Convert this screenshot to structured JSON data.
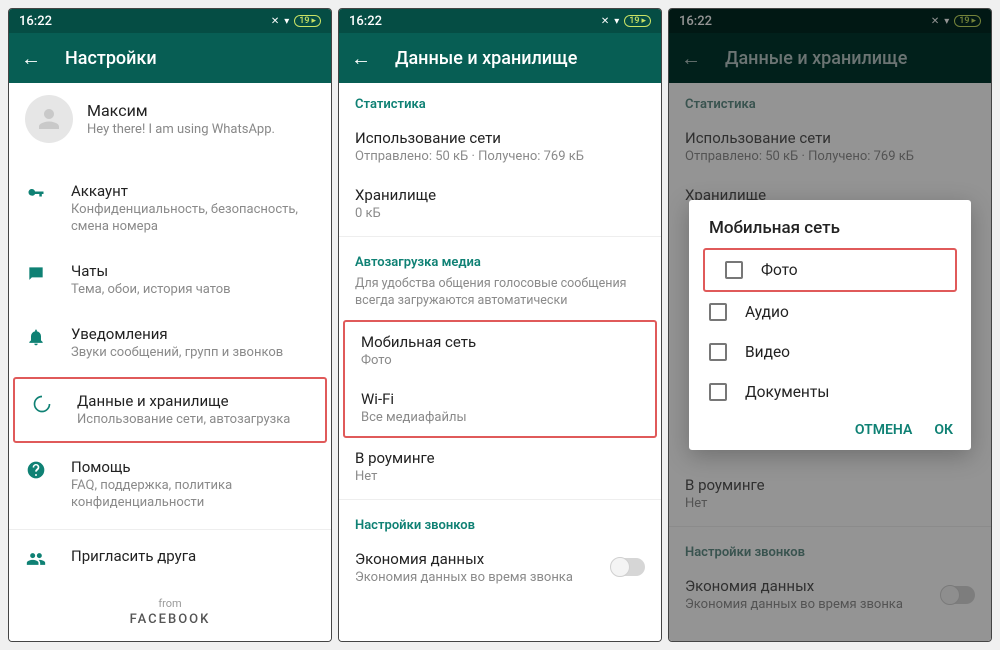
{
  "status": {
    "time": "16:22",
    "battery": "19"
  },
  "panel1": {
    "title": "Настройки",
    "profile": {
      "name": "Максим",
      "status": "Hey there! I am using WhatsApp."
    },
    "rows": {
      "account": {
        "title": "Аккаунт",
        "sub": "Конфиденциальность, безопасность, смена номера"
      },
      "chats": {
        "title": "Чаты",
        "sub": "Тема, обои, история чатов"
      },
      "notif": {
        "title": "Уведомления",
        "sub": "Звуки сообщений, групп и звонков"
      },
      "data": {
        "title": "Данные и хранилище",
        "sub": "Использование сети, автозагрузка"
      },
      "help": {
        "title": "Помощь",
        "sub": "FAQ, поддержка, политика конфиденциальности"
      },
      "invite": {
        "title": "Пригласить друга"
      }
    },
    "footer_from": "from",
    "footer_brand": "FACEBOOK"
  },
  "panel2": {
    "title": "Данные и хранилище",
    "sec_stats": "Статистика",
    "network": {
      "title": "Использование сети",
      "sub": "Отправлено: 50 кБ · Получено: 769 кБ"
    },
    "storage": {
      "title": "Хранилище",
      "sub": "0 кБ"
    },
    "sec_media": "Автозагрузка медиа",
    "media_note": "Для удобства общения голосовые сообщения всегда загружаются автоматически",
    "mobile": {
      "title": "Мобильная сеть",
      "sub": "Фото"
    },
    "wifi": {
      "title": "Wi-Fi",
      "sub": "Все медиафайлы"
    },
    "roaming": {
      "title": "В роуминге",
      "sub": "Нет"
    },
    "sec_calls": "Настройки звонков",
    "economy": {
      "title": "Экономия данных",
      "sub": "Экономия данных во время звонка"
    }
  },
  "panel3": {
    "dialog_title": "Мобильная сеть",
    "options": {
      "photo": "Фото",
      "audio": "Аудио",
      "video": "Видео",
      "docs": "Документы"
    },
    "cancel": "ОТМЕНА",
    "ok": "ОК"
  }
}
